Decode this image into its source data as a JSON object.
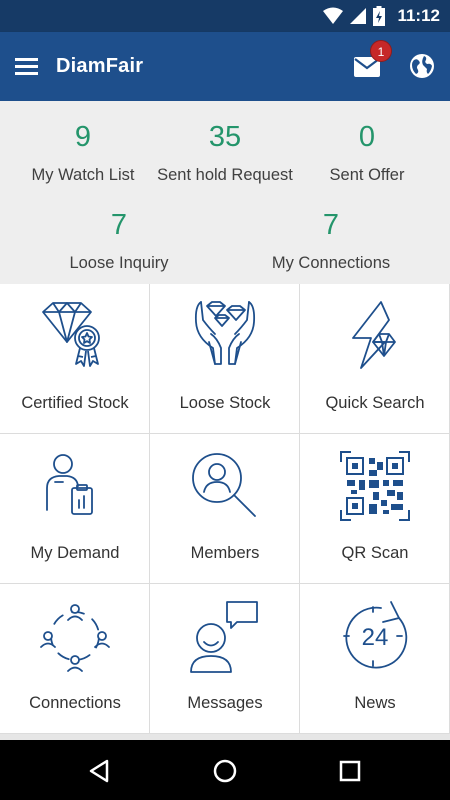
{
  "status_bar": {
    "time": "11:12",
    "icons": [
      "wifi-icon",
      "signal-icon",
      "battery-icon"
    ]
  },
  "app_bar": {
    "title": "DiamFair",
    "menu_icon": "hamburger-menu-icon",
    "mail_icon": "mail-icon",
    "mail_badge": "1",
    "globe_icon": "globe-icon"
  },
  "stats": [
    {
      "value": "9",
      "label": "My Watch List"
    },
    {
      "value": "35",
      "label": "Sent hold Request"
    },
    {
      "value": "0",
      "label": "Sent Offer"
    },
    {
      "value": "7",
      "label": "Loose Inquiry"
    },
    {
      "value": "7",
      "label": "My Connections"
    }
  ],
  "menu": [
    {
      "label": "Certified Stock",
      "icon": "certified-diamond-icon"
    },
    {
      "label": "Loose Stock",
      "icon": "hands-diamonds-icon"
    },
    {
      "label": "Quick Search",
      "icon": "lightning-diamond-icon"
    },
    {
      "label": "My Demand",
      "icon": "person-clipboard-icon"
    },
    {
      "label": "Members",
      "icon": "member-search-icon"
    },
    {
      "label": "QR Scan",
      "icon": "qr-code-icon"
    },
    {
      "label": "Connections",
      "icon": "connections-icon"
    },
    {
      "label": "Messages",
      "icon": "messages-icon"
    },
    {
      "label": "News",
      "icon": "news-24-icon"
    }
  ],
  "nav_bar": [
    "back-icon",
    "home-icon",
    "recents-icon"
  ],
  "colors": {
    "status_bar": "#163a66",
    "app_bar": "#1e4f8c",
    "stat_value": "#24956b",
    "icon_stroke": "#1e4f8c",
    "badge": "#c62828"
  }
}
